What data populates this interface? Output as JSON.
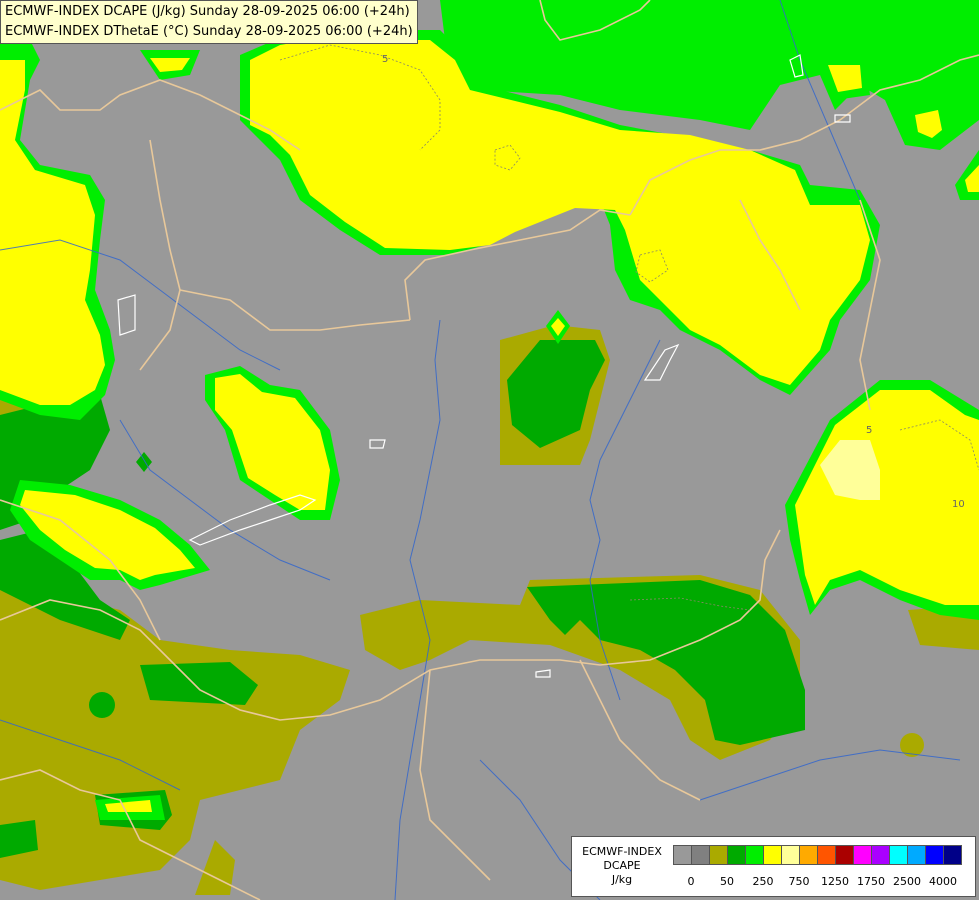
{
  "header": {
    "line1": "ECMWF-INDEX DCAPE (J/kg) Sunday 28-09-2025 06:00 (+24h)",
    "line2": "ECMWF-INDEX DThetaE (°C) Sunday 28-09-2025 06:00 (+24h)"
  },
  "map": {
    "contour_labels": [
      "5",
      "5",
      "10"
    ],
    "colors": {
      "none": "#999999",
      "lt50": "#aaaa00",
      "c50": "#00aa00",
      "c150": "#00ee00",
      "c250": "#ffff00",
      "c500": "#ffff99",
      "border": "#e8c89a",
      "river": "#3366cc",
      "lake": "#ffffff"
    }
  },
  "legend": {
    "title_lines": [
      "ECMWF-INDEX",
      "DCAPE",
      "J/kg"
    ],
    "swatch_colors": [
      "#999999",
      "#808080",
      "#aaaa00",
      "#00aa00",
      "#00ee00",
      "#ffff00",
      "#ffff99",
      "#ffaa00",
      "#ff5500",
      "#aa0000",
      "#ff00ff",
      "#aa00ff",
      "#00ffff",
      "#00aaff",
      "#0000ff",
      "#000088"
    ],
    "ticks": [
      "0",
      "50",
      "250",
      "750",
      "1250",
      "1750",
      "2500",
      "4000"
    ]
  }
}
